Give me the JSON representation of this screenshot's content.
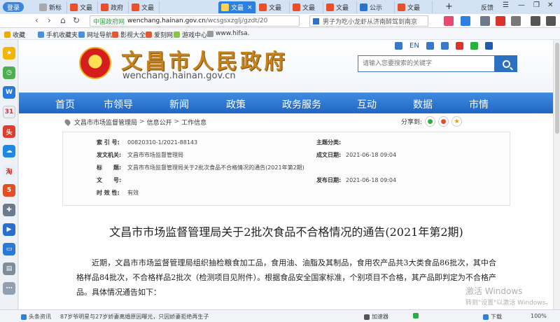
{
  "browser": {
    "login_label": "登录",
    "tabs": [
      {
        "label": "新标",
        "active": false
      },
      {
        "label": "文最",
        "active": false
      },
      {
        "label": "政府",
        "active": false
      },
      {
        "label": "文最",
        "active": false
      },
      {
        "label": "文最",
        "active": true
      },
      {
        "label": "文最",
        "active": false
      },
      {
        "label": "文最",
        "active": false
      },
      {
        "label": "文最",
        "active": false
      },
      {
        "label": "公示",
        "active": false
      },
      {
        "label": "文最",
        "active": false
      }
    ],
    "feedback_label": "反馈",
    "address": {
      "badge": "中国政府网",
      "domain": "wenchang.hainan.gov.cn",
      "path": "/wcsgsxzglj/gzdt/20"
    },
    "search_suggest": "男子为吃小龙虾从济南醉驾到南京",
    "favorites": [
      {
        "label": "收藏",
        "color": "#f2a900"
      },
      {
        "label": "手机收藏夹",
        "color": "#4a90e2"
      },
      {
        "label": "网址导航",
        "color": "#4a90e2"
      },
      {
        "label": "影视大全",
        "color": "#e35b2e"
      },
      {
        "label": "爱刻网",
        "color": "#e35b2e"
      },
      {
        "label": "游戏中心",
        "color": "#8bc34a"
      },
      {
        "label": "www.hifsa.",
        "color": "#999999"
      }
    ]
  },
  "site": {
    "title": "文昌市人民政府",
    "domain": "wenchang.hainan.gov.cn",
    "lang_en": "EN",
    "search_placeholder": "请输入您要搜索的关键字",
    "nav": [
      "首页",
      "市领导",
      "新闻",
      "政策",
      "政务服务",
      "互动",
      "数据",
      "市情"
    ]
  },
  "breadcrumb": [
    "文昌市市场监督管理局",
    "信息公开",
    "工作信息"
  ],
  "share_label": "分享到:",
  "meta": {
    "index_key": "索 引 号:",
    "index_val": "00820310-1/2021-88143",
    "theme_key": "主题分类:",
    "theme_val": "",
    "issuer_key": "发文机关:",
    "issuer_val": "文昌市市场监督管理局",
    "created_key": "成文日期:",
    "created_val": "2021-06-18 09:04",
    "title_key": "标　　题:",
    "title_val": "文昌市市场监督管理局关于2批次食品不合格情况的通告(2021年第2期)",
    "docno_key": "文　　号:",
    "docno_val": "",
    "pub_key": "发布日期:",
    "pub_val": "2021-06-18 09:04",
    "valid_key": "时 效 性:",
    "valid_val": "有效"
  },
  "document": {
    "title": "文昌市市场监督管理局关于2批次食品不合格情况的通告(2021年第2期)",
    "body": "近期，文昌市市场监督管理局组织抽检粮食加工品，食用油、油脂及其制品，食用农产品共3大类食品86批次，其中合格样品84批次，不合格样品2批次（检测项目见附件）。根据食品安全国家标准，个别项目不合格，其产品即判定为不合格产品。具体情况通告如下："
  },
  "watermark": {
    "line1": "激活 Windows",
    "line2": "转到\"设置\"以激活 Windows。"
  },
  "status": {
    "news_label": "头条资讯",
    "news_text": "87岁爷明星与27岁娇妻离婚原因曝光，只因娇妻拒绝再生子",
    "speed_label": "加速器",
    "download_label": "下载",
    "zoom": "100%"
  }
}
